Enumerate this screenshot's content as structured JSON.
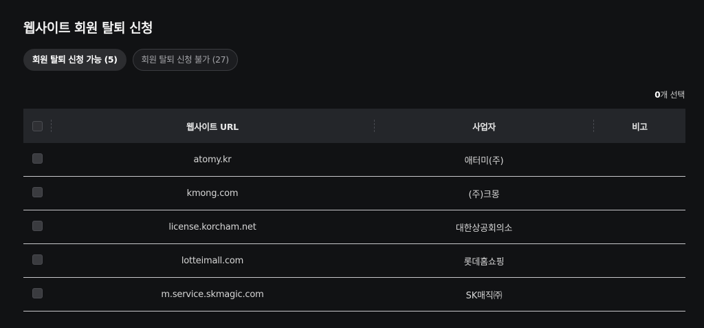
{
  "page": {
    "title": "웹사이트 회원 탈퇴 신청"
  },
  "tabs": [
    {
      "label": "회원 탈퇴 신청 가능 (5)",
      "active": true
    },
    {
      "label": "회원 탈퇴 신청 불가 (27)",
      "active": false
    }
  ],
  "selection": {
    "count": "0",
    "suffix": "개 선택"
  },
  "table": {
    "headers": {
      "url": "웹사이트 URL",
      "business": "사업자",
      "note": "비고"
    },
    "rows": [
      {
        "url": "atomy.kr",
        "business": "애터미(주)",
        "note": ""
      },
      {
        "url": "kmong.com",
        "business": "(주)크몽",
        "note": ""
      },
      {
        "url": "license.korcham.net",
        "business": "대한상공회의소",
        "note": ""
      },
      {
        "url": "lotteimall.com",
        "business": "롯데홈쇼핑",
        "note": ""
      },
      {
        "url": "m.service.skmagic.com",
        "business": "SK매직㈜",
        "note": ""
      }
    ]
  },
  "colors": {
    "background": "#111214",
    "header_bg": "#24262a",
    "active_tab_bg": "#2c2d30",
    "row_divider": "#c9c9cc"
  }
}
